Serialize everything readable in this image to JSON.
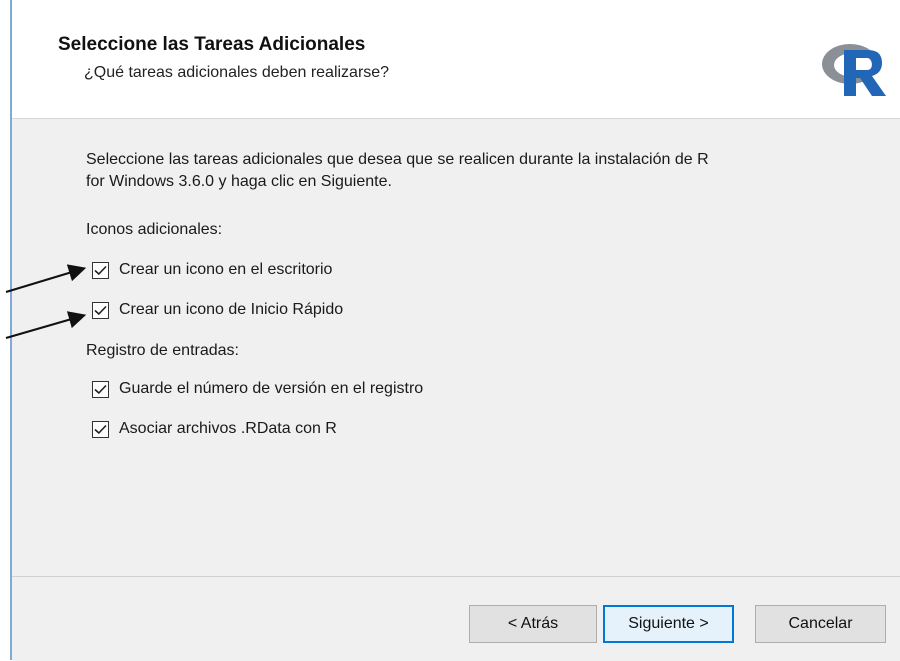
{
  "header": {
    "title": "Seleccione las Tareas Adicionales",
    "subtitle": "¿Qué tareas adicionales deben realizarse?",
    "logo_icon": "r-logo-icon"
  },
  "main": {
    "description_line1": "Seleccione las tareas adicionales que desea que se realicen durante la instalación de R",
    "description_line2": "for Windows 3.6.0 y haga clic en Siguiente.",
    "groups": [
      {
        "label": "Iconos adicionales:",
        "tasks": [
          {
            "label": "Crear un icono en el escritorio",
            "checked": true
          },
          {
            "label": "Crear un icono de Inicio Rápido",
            "checked": true
          }
        ]
      },
      {
        "label": "Registro de entradas:",
        "tasks": [
          {
            "label": "Guarde el número de versión en el registro",
            "checked": true
          },
          {
            "label": "Asociar archivos .RData con R",
            "checked": true
          }
        ]
      }
    ]
  },
  "footer": {
    "back_label": "< Atrás",
    "next_label": "Siguiente >",
    "cancel_label": "Cancelar"
  },
  "colors": {
    "panel_bg": "#f0f0f0",
    "primary_border": "#0078d7",
    "logo_gray": "#8b8f96",
    "logo_blue": "#2266b8"
  }
}
